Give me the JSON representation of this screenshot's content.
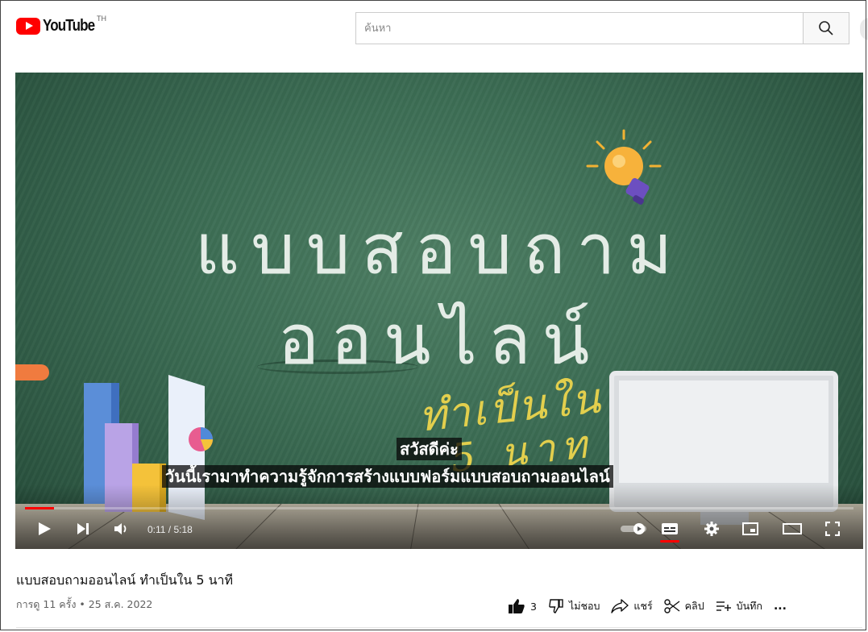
{
  "header": {
    "logo_text": "YouTube",
    "country_code": "TH",
    "search_placeholder": "ค้นหา",
    "search_icon": "search-icon"
  },
  "player": {
    "thumbnail_title_line1": "แบบสอบถาม",
    "thumbnail_title_line2": "ออนไลน์",
    "thumbnail_handwritten_line1": "ทำเป็นใน",
    "thumbnail_handwritten_line2": "5 นาท",
    "caption_line1": "สวัสดีค่ะ",
    "caption_line2": "วันนี้เรามาทำความรู้จักการสร้างแบบฟอร์มแบบสอบถามออนไลน์",
    "time_display": "0:11 / 5:18",
    "progress_fraction": 0.035,
    "captions_enabled": true,
    "accent_color": "#ff0000"
  },
  "video": {
    "title": "แบบสอบถามออนไลน์ ทำเป็นใน 5 นาที",
    "meta": "การดู 11 ครั้ง • 25 ส.ค. 2022",
    "actions": {
      "like_count": "3",
      "dislike_label": "ไม่ชอบ",
      "share_label": "แชร์",
      "clip_label": "คลิป",
      "save_label": "บันทึก",
      "more_label": "..."
    }
  }
}
